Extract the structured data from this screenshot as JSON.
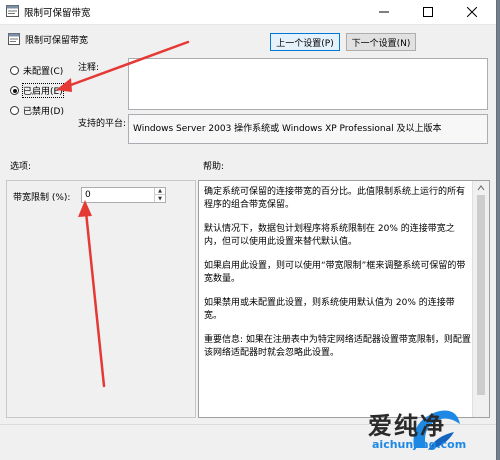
{
  "window": {
    "title": "限制可保留带宽"
  },
  "header": {
    "title": "限制可保留带宽"
  },
  "nav": {
    "prev_label": "上一个设置(P)",
    "next_label": "下一个设置(N)"
  },
  "options": [
    {
      "label": "未配置(C)",
      "selected": false
    },
    {
      "label": "已启用(E)",
      "selected": true
    },
    {
      "label": "已禁用(D)",
      "selected": false
    }
  ],
  "comment": {
    "label": "注释:",
    "value": ""
  },
  "platform": {
    "label": "支持的平台:",
    "value": "Windows Server 2003 操作系统或 Windows XP Professional 及以上版本"
  },
  "options_section": {
    "heading": "选项:",
    "bandwidth_label": "带宽限制 (%):",
    "bandwidth_value": "0"
  },
  "help": {
    "heading": "帮助:",
    "paragraphs": [
      "确定系统可保留的连接带宽的百分比。此值限制系统上运行的所有程序的组合带宽保留。",
      "默认情况下，数据包计划程序将系统限制在 20% 的连接带宽之内，但可以使用此设置来替代默认值。",
      "如果启用此设置，则可以使用“带宽限制”框来调整系统可保留的带宽数量。",
      "如果禁用或未配置此设置，则系统使用默认值为 20% 的连接带宽。",
      "重要信息: 如果在注册表中为特定网络适配器设置带宽限制，则配置该网络适配器时就会忽略此设置。"
    ]
  },
  "watermark": {
    "brand": "爱纯净",
    "url": "aichunjing.com"
  },
  "colors": {
    "arrow": "#e53935",
    "focus": "#0078d7",
    "brand_blue": "#1e88e5"
  }
}
